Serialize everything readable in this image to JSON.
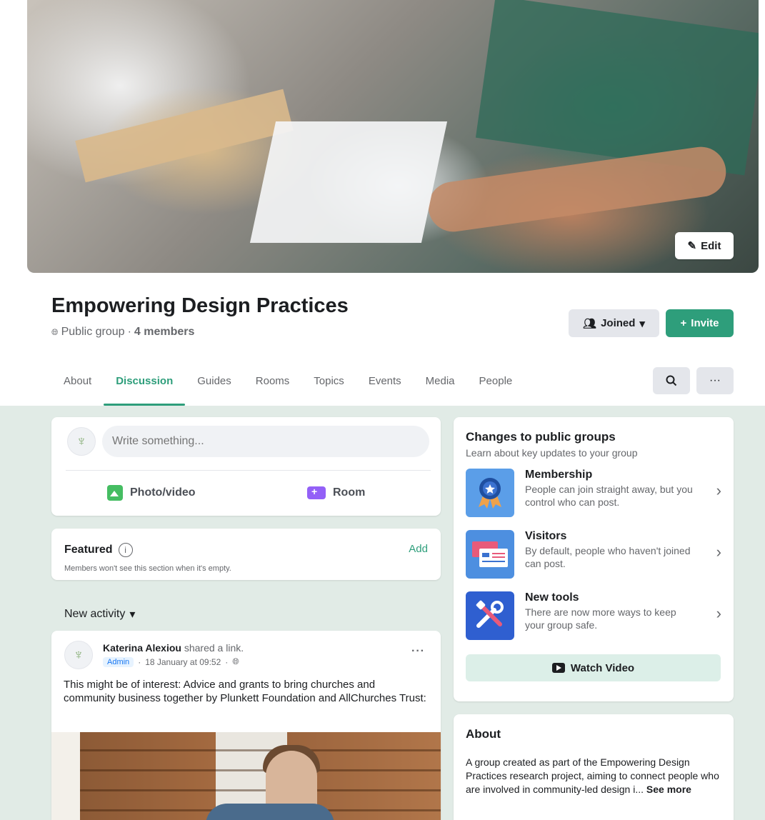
{
  "cover": {
    "edit_label": "Edit"
  },
  "group": {
    "title": "Empowering Design Practices",
    "privacy": "Public group",
    "members": "4 members"
  },
  "actions": {
    "joined_label": "Joined",
    "invite_label": "Invite"
  },
  "tabs": [
    {
      "label": "About"
    },
    {
      "label": "Discussion"
    },
    {
      "label": "Guides"
    },
    {
      "label": "Rooms"
    },
    {
      "label": "Topics"
    },
    {
      "label": "Events"
    },
    {
      "label": "Media"
    },
    {
      "label": "People"
    }
  ],
  "active_tab": "Discussion",
  "composer": {
    "placeholder": "Write something...",
    "photo_label": "Photo/video",
    "room_label": "Room"
  },
  "featured": {
    "title": "Featured",
    "subtitle": "Members won't see this section when it's empty.",
    "add_label": "Add"
  },
  "feed": {
    "sort_label": "New activity"
  },
  "post": {
    "author": "Katerina Alexiou",
    "action": "shared a link.",
    "badge": "Admin",
    "timestamp": "18 January at 09:52",
    "text": "This might be of interest: Advice and grants to bring churches and community business together by Plunkett Foundation and AllChurches Trust:"
  },
  "changes": {
    "title": "Changes to public groups",
    "subtitle": "Learn about key updates to your group",
    "items": [
      {
        "name": "Membership",
        "desc": "People can join straight away, but you control who can post."
      },
      {
        "name": "Visitors",
        "desc": "By default, people who haven't joined can post."
      },
      {
        "name": "New tools",
        "desc": "There are now more ways to keep your group safe."
      }
    ],
    "watch_label": "Watch Video"
  },
  "about": {
    "title": "About",
    "text": "A group created as part of the Empowering Design Practices research project, aiming to connect people who are involved in community-led design i...",
    "see_more": "See more"
  },
  "colors": {
    "accent": "#2e9e7b",
    "page_bg": "#e1ebe6"
  }
}
